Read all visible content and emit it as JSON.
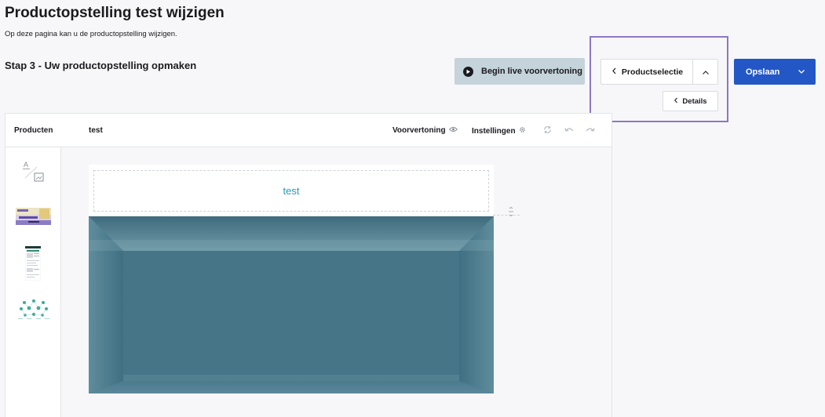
{
  "page": {
    "title": "Productopstelling test wijzigen",
    "subtitle": "Op deze pagina kan u de productopstelling wijzigen.",
    "step_title": "Stap 3 - Uw productopstelling opmaken"
  },
  "toolbar": {
    "preview_label": "Begin live voorvertoning",
    "productselectie_label": "Productselectie",
    "details_label": "Details",
    "save_label": "Opslaan"
  },
  "editor": {
    "tab_products": "Producten",
    "tab_name": "test",
    "preview_label": "Voorvertoning",
    "settings_label": "Instellingen",
    "block_text": "test"
  },
  "icons": {
    "preview": "play-circle-icon",
    "back": "chevron-left-icon",
    "collapse": "chevron-up-icon",
    "save_menu": "chevron-down-icon",
    "eye": "eye-icon",
    "gear": "gear-icon",
    "refresh": "refresh-icon",
    "undo": "undo-icon",
    "redo": "redo-icon",
    "text_image": "text-image-icon",
    "resize": "resize-handle-icon"
  },
  "colors": {
    "accent": "#2357c6",
    "highlight": "#8c78c4",
    "link": "#2b97b6",
    "preview_button": "#c5d3da"
  }
}
